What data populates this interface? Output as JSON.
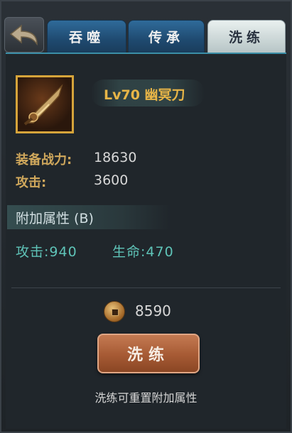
{
  "tabs": [
    {
      "label": "吞噬",
      "active": false
    },
    {
      "label": "传承",
      "active": false
    },
    {
      "label": "洗练",
      "active": true
    }
  ],
  "item": {
    "name": "Lv70 幽冥刀"
  },
  "stats": {
    "power_label": "装备战力:",
    "power_value": "18630",
    "attack_label": "攻击:",
    "attack_value": "3600"
  },
  "bonus": {
    "title": "附加属性 (B)",
    "attack": "攻击:940",
    "life": "生命:470"
  },
  "cost": {
    "amount": "8590"
  },
  "action": {
    "button_label": "洗练",
    "hint": "洗练可重置附加属性"
  },
  "colors": {
    "accent_gold": "#e8b547",
    "attr_teal": "#5fc4b8",
    "tab_blue": "#2f6b9a",
    "button_brown": "#a65a34"
  }
}
